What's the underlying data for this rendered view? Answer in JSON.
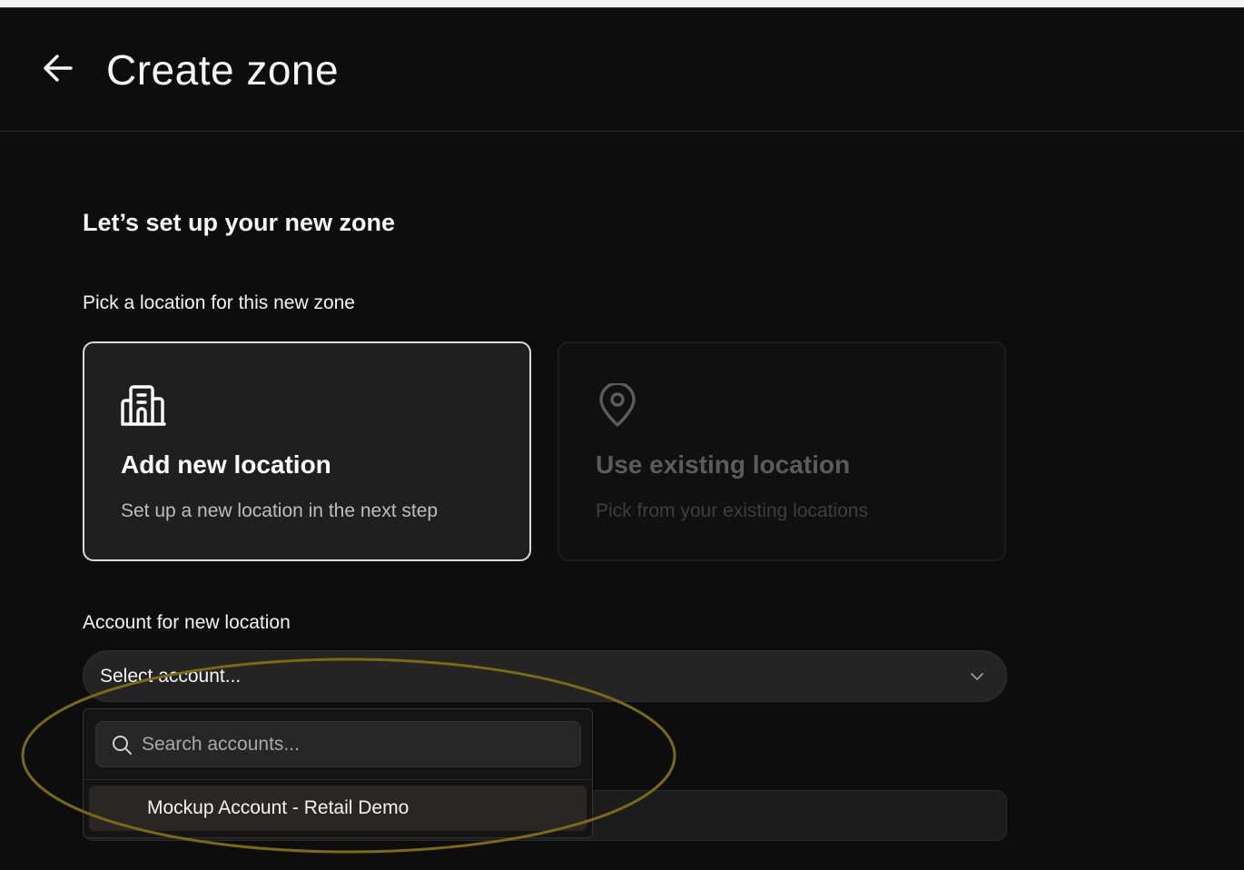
{
  "header": {
    "title": "Create zone",
    "back_icon": "arrow-left-icon"
  },
  "main": {
    "section_title": "Let’s set up your new zone",
    "location_label": "Pick a location for this new zone",
    "cards": [
      {
        "icon": "building-icon",
        "title": "Add new location",
        "subtitle": "Set up a new location in the next step",
        "selected": true
      },
      {
        "icon": "map-pin-icon",
        "title": "Use existing location",
        "subtitle": "Pick from your existing locations",
        "selected": false
      }
    ],
    "account_label": "Account for new location",
    "account_select": {
      "value": "Select account...",
      "icon": "chevron-down-icon"
    },
    "dropdown": {
      "search_placeholder": "Search accounts...",
      "search_icon": "search-icon",
      "options": [
        "Mockup Account - Retail Demo"
      ]
    }
  },
  "colors": {
    "background": "#0d0d0d",
    "card_selected_bg": "#1f1f1f",
    "card_selected_border": "#d9d9d9",
    "annotation_ellipse": "#7a6a14"
  }
}
